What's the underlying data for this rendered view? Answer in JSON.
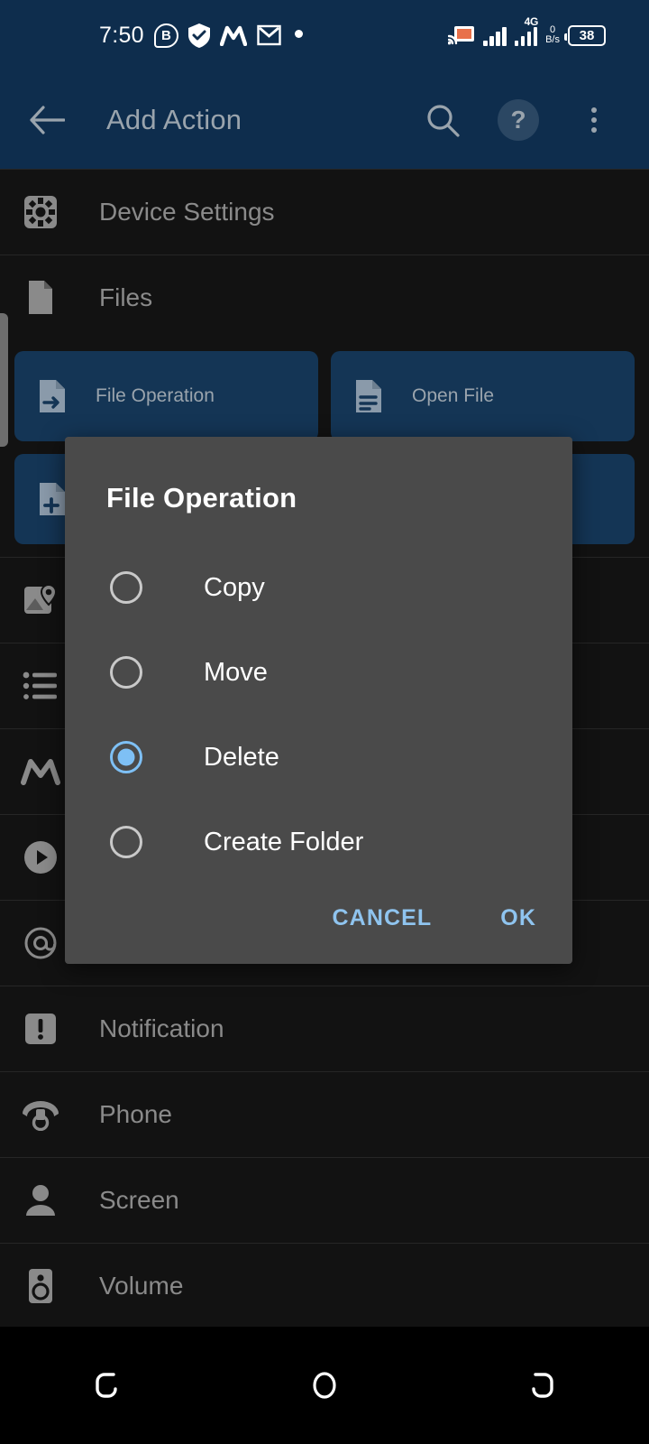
{
  "status_bar": {
    "time": "7:50",
    "left_icons": [
      "b-badge-icon",
      "shield-check-icon",
      "macrodroid-icon",
      "gmail-icon",
      "dot-icon"
    ],
    "b_badge": "B",
    "network_type": "4G",
    "data_rate_value": "0",
    "data_rate_unit": "B/s",
    "battery_percent": "38",
    "right_icons": [
      "cast-icon",
      "signal-bars-icon",
      "signal-bars-4g-icon",
      "data-rate-icon",
      "battery-icon"
    ]
  },
  "app_bar": {
    "back_icon": "back-arrow-icon",
    "title": "Add Action",
    "search_icon": "search-icon",
    "help_label": "?",
    "help_icon": "help-circle-icon",
    "overflow_icon": "overflow-menu-icon"
  },
  "list": {
    "items": [
      {
        "label": "Device Settings",
        "icon": "gear-icon"
      },
      {
        "label": "Files",
        "icon": "file-icon"
      }
    ],
    "file_chips": [
      {
        "label": "File Operation",
        "icon": "file-arrow-icon"
      },
      {
        "label": "Open File",
        "icon": "file-lines-icon"
      }
    ],
    "file_chips_row2": [
      {
        "label": "",
        "icon": "file-plus-icon"
      }
    ],
    "icon_only_rows": [
      {
        "icon": "map-location-icon"
      },
      {
        "icon": "list-icon"
      },
      {
        "icon": "macrodroid-icon"
      },
      {
        "icon": "play-circle-icon"
      },
      {
        "icon": "at-sign-icon"
      }
    ],
    "bottom_items": [
      {
        "label": "Notification",
        "icon": "notification-badge-icon"
      },
      {
        "label": "Phone",
        "icon": "phone-rotary-icon"
      },
      {
        "label": "Screen",
        "icon": "person-icon"
      },
      {
        "label": "Volume",
        "icon": "speaker-icon"
      }
    ]
  },
  "dialog": {
    "title": "File Operation",
    "options": [
      {
        "label": "Copy",
        "selected": false
      },
      {
        "label": "Move",
        "selected": false
      },
      {
        "label": "Delete",
        "selected": true
      },
      {
        "label": "Create Folder",
        "selected": false
      }
    ],
    "cancel_label": "CANCEL",
    "ok_label": "OK"
  },
  "nav_bar": {
    "back_icon": "nav-back-icon",
    "home_icon": "nav-home-icon",
    "recents_icon": "nav-recents-icon"
  },
  "colors": {
    "app_bar_bg": "#0e2d4d",
    "page_bg": "#121212",
    "chip_bg": "#143555",
    "dialog_bg": "#4a4a4a",
    "accent": "#7ec0f5",
    "button_text": "#8fc4ef",
    "muted_text": "#8a8a8a"
  }
}
